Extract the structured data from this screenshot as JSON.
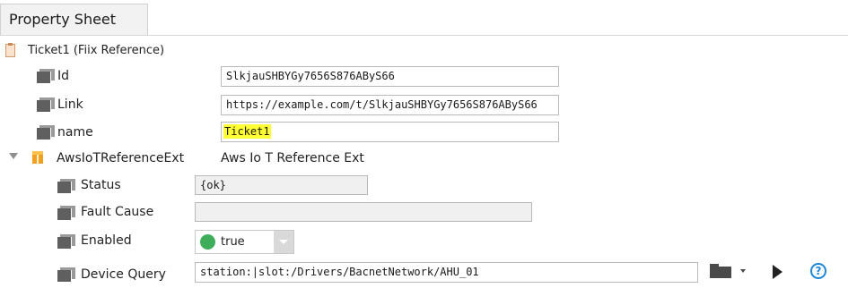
{
  "tab": {
    "title": "Property Sheet"
  },
  "root": {
    "label": "Ticket1  (Fiix Reference)"
  },
  "properties": {
    "id": {
      "label": "Id",
      "value": "SlkjauSHBYGy7656S876AByS66"
    },
    "link": {
      "label": "Link",
      "value": "https://example.com/t/SlkjauSHBYGy7656S876AByS66"
    },
    "name": {
      "label": "name",
      "value": "Ticket1"
    }
  },
  "extension": {
    "name": "AwsIoTReferenceExt",
    "type": "Aws Io T Reference Ext",
    "status": {
      "label": "Status",
      "value": "{ok}"
    },
    "fault_cause": {
      "label": "Fault Cause",
      "value": ""
    },
    "enabled": {
      "label": "Enabled",
      "value": "true",
      "indicator_color": "#3fae5b"
    },
    "device_query": {
      "label": "Device Query",
      "value": "station:|slot:/Drivers/BacnetNetwork/AHU_01"
    }
  },
  "icons": {
    "root": "component-icon",
    "slot": "slot-icon",
    "extension": "cube-icon",
    "expand": "expand-triangle-icon",
    "browse": "folder-icon",
    "dropdown": "chevron-down-icon",
    "invoke": "play-icon",
    "help": "help-icon"
  },
  "help_glyph": "?",
  "colors": {
    "highlight": "#ffff33",
    "help": "#1e88d8",
    "enabled_dot": "#3fae5b"
  }
}
